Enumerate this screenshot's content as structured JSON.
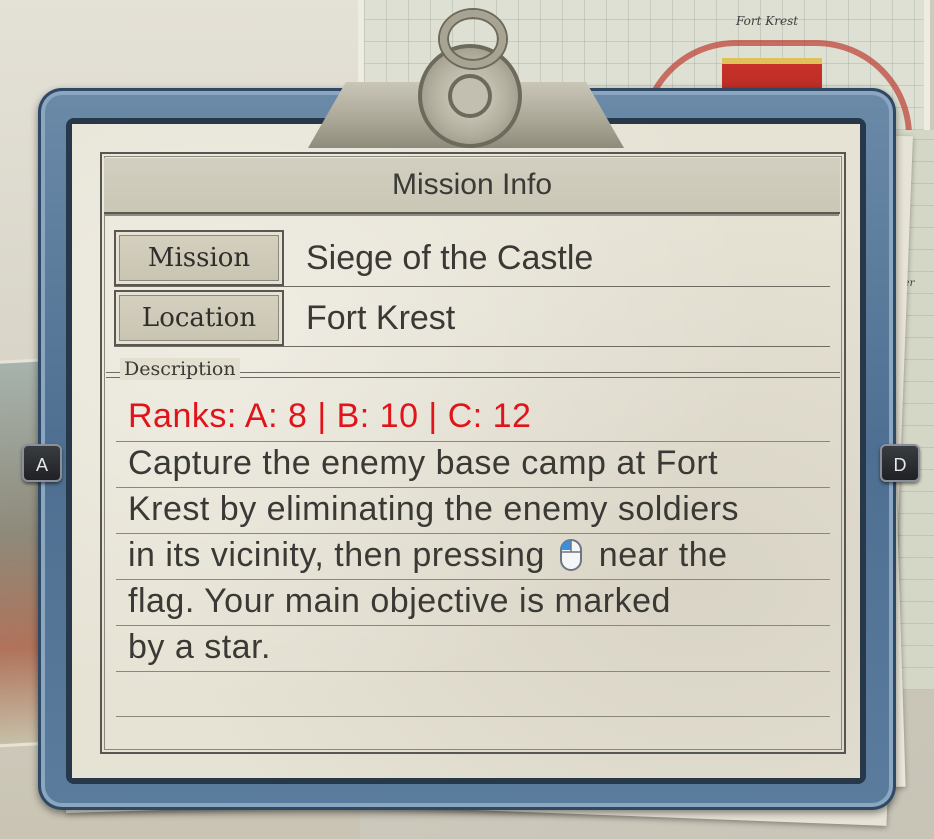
{
  "background": {
    "map_top_label": "Fort Krest",
    "map_right_label": "ver"
  },
  "panel": {
    "title": "Mission Info",
    "rows": [
      {
        "label": "Mission",
        "value": "Siege of the Castle"
      },
      {
        "label": "Location",
        "value": "Fort Krest"
      }
    ],
    "description_label": "Description",
    "ranks_line": "Ranks: A: 8 | B: 10 | C: 12",
    "description_lines": [
      "Capture the enemy base camp at Fort",
      "Krest by eliminating the enemy soldiers",
      "in its vicinity, then pressing",
      "near the",
      "flag. Your main objective is marked",
      "by a star."
    ],
    "inline_icon": "mouse-left-click-icon"
  },
  "keys": {
    "left": "A",
    "right": "D"
  },
  "colors": {
    "ranks": "#e0141a",
    "frame": "#4e6f91",
    "paper": "#e6e2d4"
  }
}
